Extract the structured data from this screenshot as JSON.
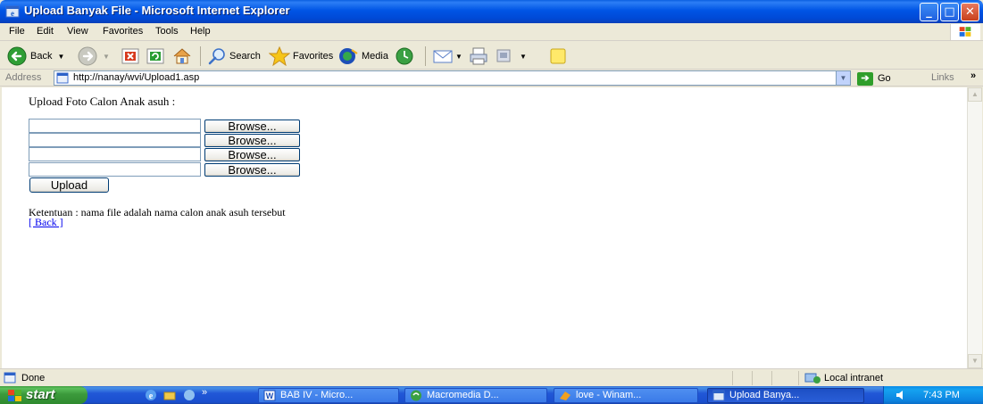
{
  "window": {
    "title": "Upload Banyak File - Microsoft Internet Explorer",
    "buttons": {
      "minimize": "_",
      "maximize": "□",
      "close": "✕"
    }
  },
  "menu": [
    "File",
    "Edit",
    "View",
    "Favorites",
    "Tools",
    "Help"
  ],
  "toolbar": {
    "back": "Back",
    "search": "Search",
    "favorites": "Favorites",
    "media": "Media"
  },
  "address": {
    "label": "Address",
    "url": "http://nanay/wvi/Upload1.asp",
    "go": "Go",
    "links": "Links"
  },
  "page": {
    "heading": "Upload Foto Calon Anak asuh :",
    "browse_label": "Browse...",
    "upload_label": "Upload",
    "rule_text": "Ketentuan : nama file adalah nama calon anak asuh tersebut",
    "back_link": "[ Back ]",
    "file_inputs": [
      "",
      "",
      "",
      ""
    ]
  },
  "status": {
    "text": "Done",
    "zone": "Local intranet"
  },
  "taskbar": {
    "start": "start",
    "quicklaunch_more": "»",
    "tasks": [
      {
        "label": "BAB IV - Micro...",
        "icon": "word-icon",
        "active": false
      },
      {
        "label": "Macromedia D...",
        "icon": "dreamweaver-icon",
        "active": false
      },
      {
        "label": "love - Winam...",
        "icon": "winamp-icon",
        "active": false
      },
      {
        "label": "Upload Banya...",
        "icon": "ie-icon",
        "active": true
      }
    ],
    "clock": "7:43 PM"
  },
  "colors": {
    "titlebar": "#0055e5",
    "link": "#0000ee",
    "taskbar": "#2157d7",
    "start": "#3c9a3c"
  }
}
